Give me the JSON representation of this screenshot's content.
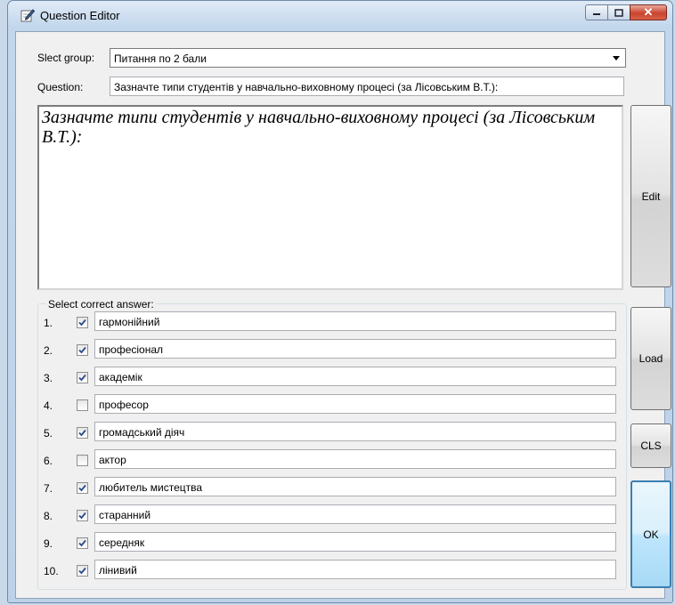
{
  "window": {
    "title": "Question Editor"
  },
  "form": {
    "group_label": "Slect group:",
    "group_value": "Питання по 2 бали",
    "question_label": "Question:",
    "question_value": "Зазначте типи студентів у навчально-виховному процесі (за Лісовським В.Т.):",
    "rich_text": "Зазначте типи студентів у навчально-виховному процесі (за Лісовським В.Т.):"
  },
  "buttons": {
    "edit": "Edit",
    "load": "Load",
    "cls": "CLS",
    "ok": "OK"
  },
  "answers": {
    "title": "Select correct answer:",
    "items": [
      {
        "num": "1.",
        "checked": true,
        "text": "гармонійний"
      },
      {
        "num": "2.",
        "checked": true,
        "text": "професіонал"
      },
      {
        "num": "3.",
        "checked": true,
        "text": "академік"
      },
      {
        "num": "4.",
        "checked": false,
        "text": "професор"
      },
      {
        "num": "5.",
        "checked": true,
        "text": "громадський діяч"
      },
      {
        "num": "6.",
        "checked": false,
        "text": "актор"
      },
      {
        "num": "7.",
        "checked": true,
        "text": "любитель мистецтва"
      },
      {
        "num": "8.",
        "checked": true,
        "text": "старанний"
      },
      {
        "num": "9.",
        "checked": true,
        "text": "середняк"
      },
      {
        "num": "10.",
        "checked": true,
        "text": "лінивий"
      }
    ]
  },
  "colors": {
    "titlebar": "#c2d6ec",
    "client": "#f0f0f0",
    "ok_border": "#3c7fb1",
    "close": "#c9442e"
  }
}
